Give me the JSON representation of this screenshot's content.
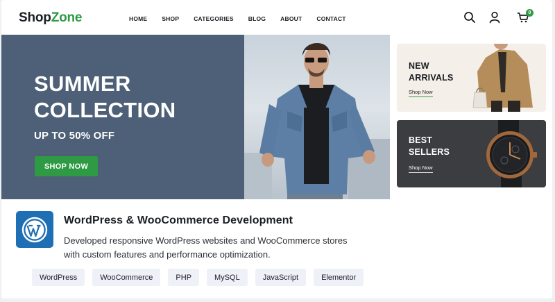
{
  "header": {
    "logo_part1": "Shop",
    "logo_part2": "Zone",
    "nav": [
      "HOME",
      "SHOP",
      "CATEGORIES",
      "BLOG",
      "ABOUT",
      "CONTACT"
    ],
    "cart_count": "0",
    "icons": [
      "search-icon",
      "user-icon",
      "cart-icon"
    ]
  },
  "hero": {
    "title_line1": "SUMMER",
    "title_line2": "COLLECTION",
    "subtitle": "UP TO 50% OFF",
    "cta": "SHOP NOW"
  },
  "promos": {
    "new_arrivals": {
      "line1": "NEW",
      "line2": "ARRIVALS",
      "link": "Shop Now"
    },
    "best_sellers": {
      "line1": "BEST",
      "line2": "SELLERS",
      "link": "Shop Now"
    }
  },
  "card": {
    "title": "WordPress & WooCommerce Development",
    "description": "Developed responsive WordPress websites and WooCommerce stores with custom features and performance optimization.",
    "tags": [
      "WordPress",
      "WooCommerce",
      "PHP",
      "MySQL",
      "JavaScript",
      "Elementor"
    ]
  },
  "colors": {
    "brand_green": "#2e9a44",
    "hero_blue": "#4d6077",
    "wordpress_blue": "#1f6fb5"
  }
}
